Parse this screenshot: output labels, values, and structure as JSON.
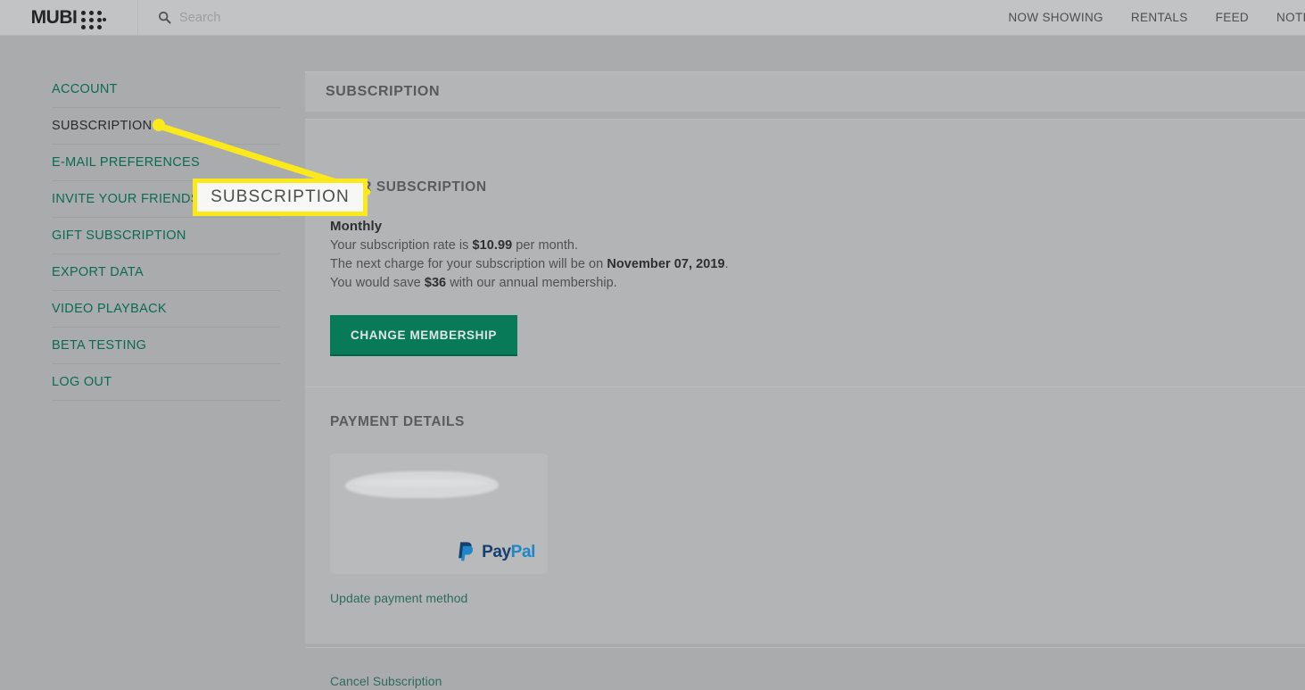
{
  "header": {
    "logo_text": "MUBI",
    "logo_icon": "mubi-dots-logo",
    "search": {
      "icon": "search-icon",
      "placeholder": "Search",
      "value": ""
    },
    "nav": [
      {
        "label": "NOW SHOWING"
      },
      {
        "label": "RENTALS"
      },
      {
        "label": "FEED"
      },
      {
        "label": "NOTEBOO"
      }
    ]
  },
  "sidebar": {
    "items": [
      {
        "label": "ACCOUNT",
        "active": false
      },
      {
        "label": "SUBSCRIPTION",
        "active": true
      },
      {
        "label": "E-MAIL PREFERENCES",
        "active": false
      },
      {
        "label": "INVITE YOUR FRIENDS",
        "active": false
      },
      {
        "label": "GIFT SUBSCRIPTION",
        "active": false
      },
      {
        "label": "EXPORT DATA",
        "active": false
      },
      {
        "label": "VIDEO PLAYBACK",
        "active": false
      },
      {
        "label": "BETA TESTING",
        "active": false
      },
      {
        "label": "LOG OUT",
        "active": false
      }
    ]
  },
  "main": {
    "page_title": "SUBSCRIPTION",
    "subscription": {
      "section_title": "YOUR SUBSCRIPTION",
      "plan_name": "Monthly",
      "rate_line_prefix": "Your subscription rate is ",
      "rate_amount": "$10.99",
      "rate_line_suffix": " per month.",
      "next_charge_prefix": "The next charge for your subscription will be on ",
      "next_charge_date": "November 07, 2019",
      "next_charge_suffix": ".",
      "savings_prefix": "You would save ",
      "savings_amount": "$36",
      "savings_suffix": " with our annual membership.",
      "change_button": "CHANGE MEMBERSHIP"
    },
    "payment": {
      "section_title": "PAYMENT DETAILS",
      "method_icon": "paypal-logo",
      "method_word_a": "Pay",
      "method_word_b": "Pal",
      "account_redacted": "",
      "update_link": "Update payment method"
    },
    "cancel_link": "Cancel Subscription"
  },
  "annotation": {
    "callout_label": "SUBSCRIPTION",
    "callout_border_color": "#fbe91b",
    "pointer_color": "#fbe91b",
    "target": "sidebar-item-subscription"
  },
  "colors": {
    "page_background": "#aaabad",
    "header_background": "#c2c3c5",
    "card_background": "#b3b4b6",
    "accent_green": "#087a58",
    "link_green": "#2e6b5c",
    "sidebar_link": "#0b6b52",
    "annotation_yellow": "#fbe91b"
  }
}
